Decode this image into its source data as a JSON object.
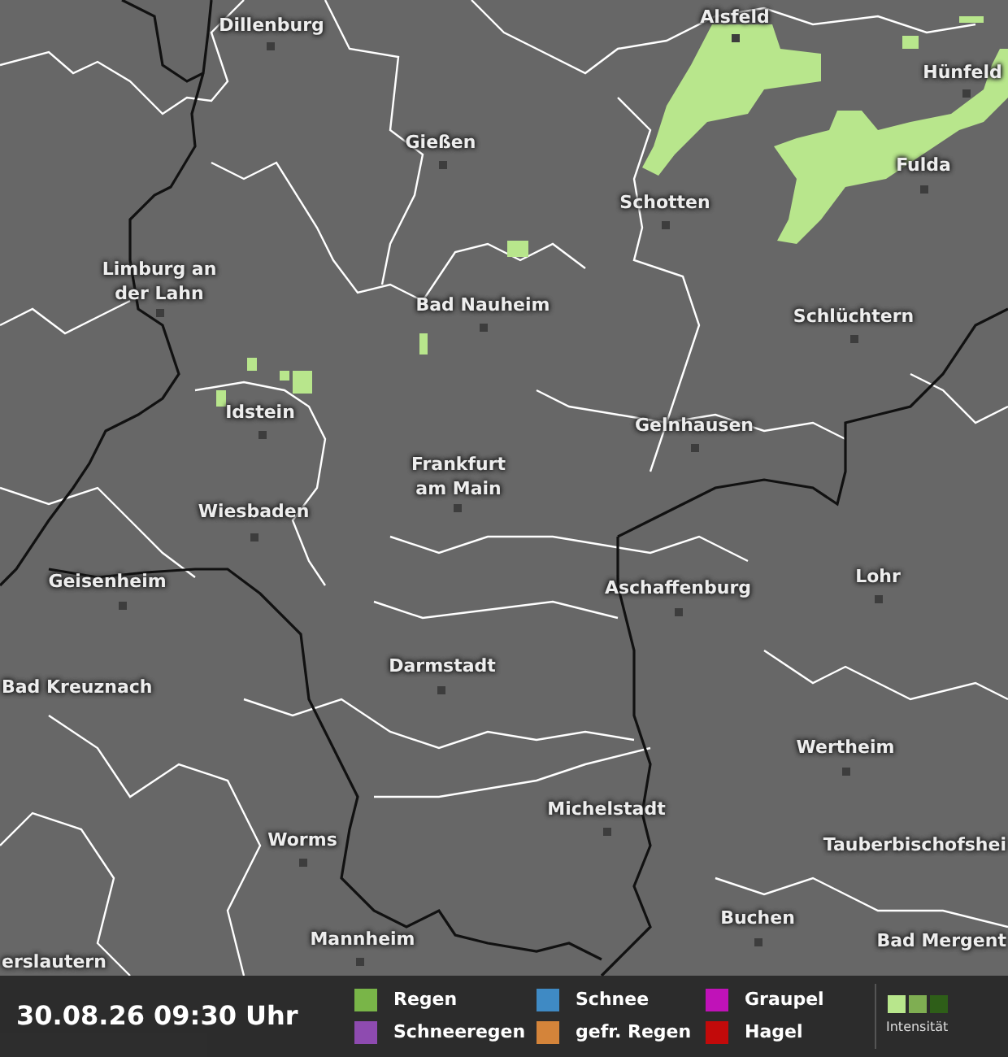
{
  "map": {
    "cities": [
      {
        "name": "Dillenburg"
      },
      {
        "name": "Gießen"
      },
      {
        "name": "Limburg an der Lahn"
      },
      {
        "name": "Bad Nauheim"
      },
      {
        "name": "Idstein"
      },
      {
        "name": "Frankfurt am Main"
      },
      {
        "name": "Wiesbaden"
      },
      {
        "name": "Geisenheim"
      },
      {
        "name": "Bad Kreuznach"
      },
      {
        "name": "Darmstadt"
      },
      {
        "name": "Worms"
      },
      {
        "name": "Mannheim"
      },
      {
        "name": "Alsfeld"
      },
      {
        "name": "Hünfeld"
      },
      {
        "name": "Fulda"
      },
      {
        "name": "Schotten"
      },
      {
        "name": "Schlüchtern"
      },
      {
        "name": "Gelnhausen"
      },
      {
        "name": "Aschaffenburg"
      },
      {
        "name": "Lohr"
      },
      {
        "name": "Wertheim"
      },
      {
        "name": "Michelstadt"
      },
      {
        "name": "Tauberbischofshei"
      },
      {
        "name": "Buchen"
      },
      {
        "name": "Bad Mergent"
      },
      {
        "name": "erslautern"
      }
    ]
  },
  "status_bar": {
    "timestamp": "30.08.26 09:30 Uhr",
    "legend": [
      {
        "label": "Regen",
        "color": "#79b548"
      },
      {
        "label": "Schnee",
        "color": "#3f8ac4"
      },
      {
        "label": "Graupel",
        "color": "#c012b8"
      },
      {
        "label": "Schneeregen",
        "color": "#8e4bb0"
      },
      {
        "label": "gefr. Regen",
        "color": "#d4843a"
      },
      {
        "label": "Hagel",
        "color": "#c20a0a"
      }
    ],
    "intensity": {
      "label": "Intensität",
      "levels": [
        {
          "color": "#b8e68c"
        },
        {
          "color": "#7fae52"
        },
        {
          "color": "#2e5e18"
        }
      ]
    }
  }
}
